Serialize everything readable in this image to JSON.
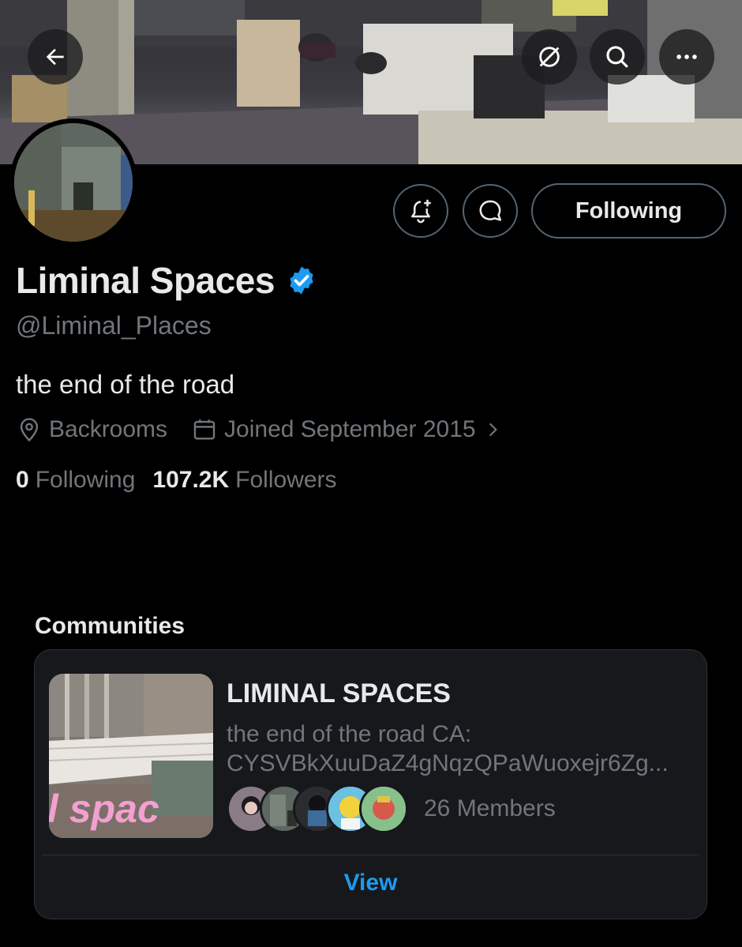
{
  "header": {
    "back_icon": "arrow-left-icon",
    "grok_icon": "grok-icon",
    "search_icon": "search-icon",
    "more_icon": "more-horizontal-icon"
  },
  "profile": {
    "name": "Liminal Spaces",
    "verified": true,
    "verified_color": "#1d9bf0",
    "handle": "@Liminal_Places",
    "bio": "the end of the road",
    "location": "Backrooms",
    "joined": "Joined September 2015",
    "following_count": "0",
    "following_label": "Following",
    "followers_count": "107.2K",
    "followers_label": "Followers"
  },
  "actions": {
    "notify_icon": "bell-plus-icon",
    "message_icon": "message-icon",
    "follow_button_label": "Following"
  },
  "communities": {
    "section_title": "Communities",
    "card": {
      "name": "LIMINAL SPACES",
      "description_line1": "the end of the road CA:",
      "description_line2": "CYSVBkXuuDaZ4gNqzQPaWuoxejr6Zg...",
      "thumbnail_text": "l spac",
      "members_label": "26 Members",
      "view_label": "View"
    }
  },
  "colors": {
    "background": "#000000",
    "text_primary": "#e7e9ea",
    "text_secondary": "#71767b",
    "border": "#536471",
    "accent": "#1d9bf0"
  }
}
